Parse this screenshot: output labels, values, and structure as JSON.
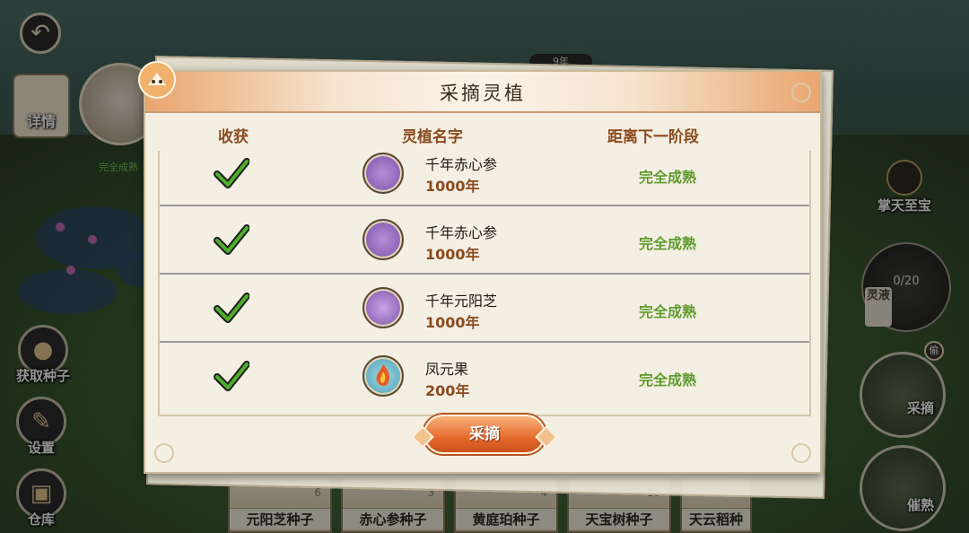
{
  "modal": {
    "title": "采摘灵植",
    "columns": [
      "收获",
      "灵植名字",
      "距离下一阶段"
    ],
    "plants": [
      {
        "name": "千年赤心参",
        "age": "1000年",
        "status": "完全成熟",
        "checked": true,
        "icon": "red-ginseng-icon",
        "icon_color": "#8e63b8"
      },
      {
        "name": "千年赤心参",
        "age": "1000年",
        "status": "完全成熟",
        "checked": true,
        "icon": "red-ginseng-icon",
        "icon_color": "#8e63b8"
      },
      {
        "name": "千年元阳芝",
        "age": "1000年",
        "status": "完全成熟",
        "checked": true,
        "icon": "yuanyang-mushroom-icon",
        "icon_color": "#8e63b8"
      },
      {
        "name": "凤元果",
        "age": "200年",
        "status": "完全成熟",
        "checked": true,
        "icon": "phoenix-fruit-icon",
        "icon_color": "#5fb6c9"
      }
    ],
    "harvest_button": "采摘"
  },
  "left_menu": {
    "detail": "详情",
    "get_seeds": "获取种子",
    "settings": "设置",
    "warehouse": "仓库",
    "partial_status": "完全成熟"
  },
  "right_menu": {
    "treasure": "掌天至宝",
    "bag_count": "0/20",
    "bag_tag": "灵液",
    "harvest": "采摘",
    "harvest_badge": "偷",
    "ripen": "催熟"
  },
  "year_indicator": "9年",
  "seed_bar": [
    {
      "name": "元阳芝种子",
      "count": "6"
    },
    {
      "name": "赤心参种子",
      "count": "3"
    },
    {
      "name": "黄庭珀种子",
      "count": "4"
    },
    {
      "name": "天宝树种子",
      "count": "10"
    },
    {
      "name": "天云稻种",
      "count": ""
    }
  ],
  "colors": {
    "accent_orange": "#e4692d",
    "status_green": "#5f9a2c",
    "header_brown": "#8a4a1f"
  }
}
